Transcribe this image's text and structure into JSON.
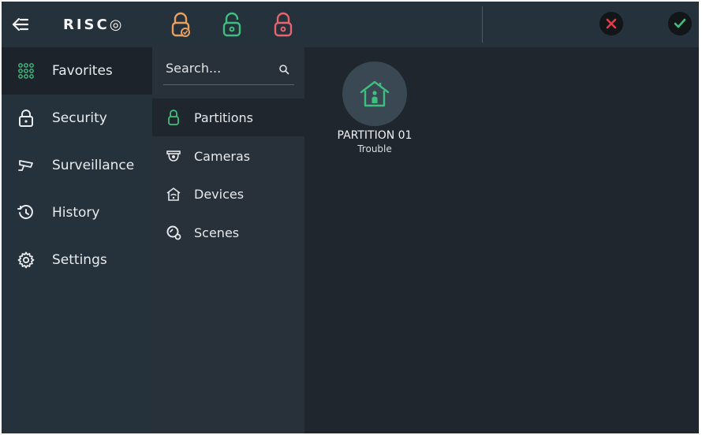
{
  "app": {
    "logo": "RISC◎"
  },
  "topbar": {
    "back_icon": "back-arrow-icon",
    "lock_buttons": [
      {
        "icon": "armed-stay-lock-icon",
        "color": "#e8a060"
      },
      {
        "icon": "unlocked-lock-icon",
        "color": "#3fbf7f"
      },
      {
        "icon": "locked-lock-icon",
        "color": "#e8646e"
      }
    ],
    "cancel_icon": "close-icon",
    "cancel_color": "#e23c4b",
    "confirm_icon": "check-icon",
    "confirm_color": "#3fbf7f"
  },
  "sidebar": {
    "items": [
      {
        "label": "Favorites",
        "icon": "grid-icon",
        "active": true
      },
      {
        "label": "Security",
        "icon": "lock-icon",
        "active": false
      },
      {
        "label": "Surveillance",
        "icon": "camera-icon",
        "active": false
      },
      {
        "label": "History",
        "icon": "history-icon",
        "active": false
      },
      {
        "label": "Settings",
        "icon": "gear-icon",
        "active": false
      }
    ]
  },
  "subpanel": {
    "search_placeholder": "Search...",
    "items": [
      {
        "label": "Partitions",
        "icon": "lock-icon",
        "active": true
      },
      {
        "label": "Cameras",
        "icon": "dome-camera-icon",
        "active": false
      },
      {
        "label": "Devices",
        "icon": "home-wifi-icon",
        "active": false
      },
      {
        "label": "Scenes",
        "icon": "scene-icon",
        "active": false
      }
    ]
  },
  "main": {
    "tiles": [
      {
        "name": "PARTITION 01",
        "status": "Trouble",
        "icon": "house-person-icon",
        "accent": "#3fbf7f"
      }
    ]
  }
}
